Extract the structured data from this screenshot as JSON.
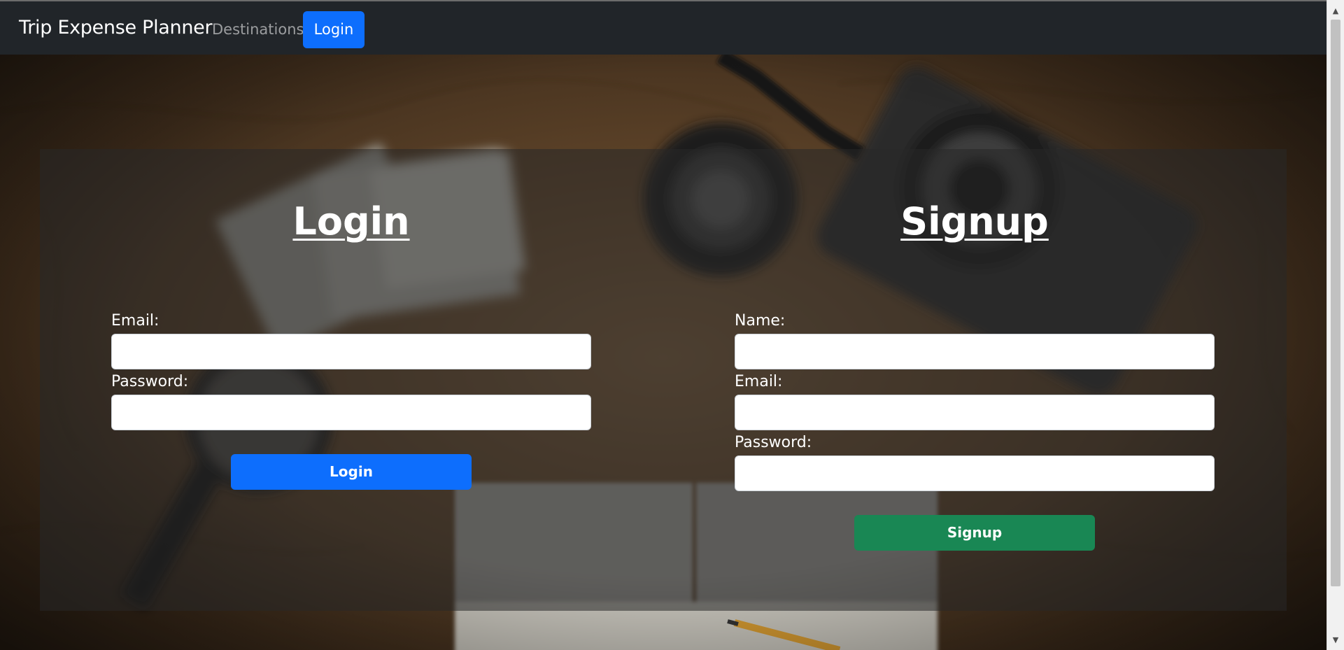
{
  "navbar": {
    "brand": "Trip Expense Planner",
    "links": [
      {
        "label": "Destinations"
      },
      {
        "label": "Login"
      }
    ]
  },
  "login_form": {
    "title": "Login",
    "fields": [
      {
        "label": "Email:",
        "value": ""
      },
      {
        "label": "Password:",
        "value": ""
      }
    ],
    "submit_label": "Login"
  },
  "signup_form": {
    "title": "Signup",
    "fields": [
      {
        "label": "Name:",
        "value": ""
      },
      {
        "label": "Email:",
        "value": ""
      },
      {
        "label": "Password:",
        "value": ""
      }
    ],
    "submit_label": "Signup"
  },
  "colors": {
    "navbar_bg": "#212529",
    "primary": "#0d6efd",
    "success": "#198754"
  }
}
